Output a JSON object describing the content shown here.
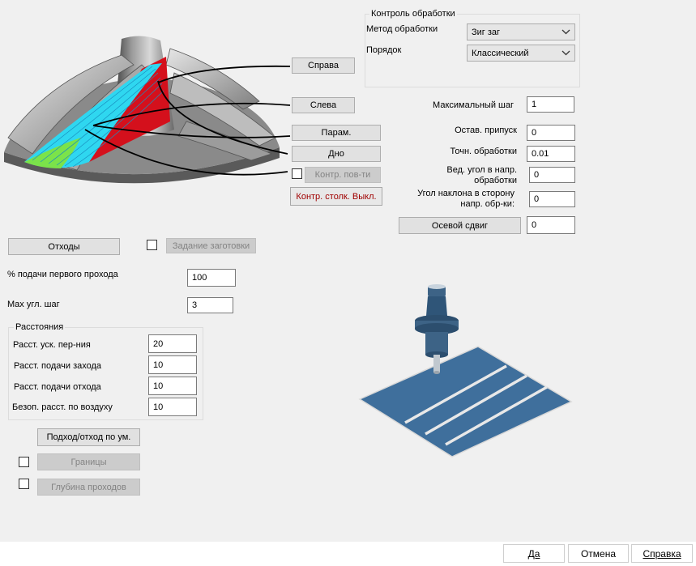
{
  "machining_control": {
    "title": "Контроль обработки",
    "method_label": "Метод обработки",
    "method_value": "Зиг заг",
    "order_label": "Порядок",
    "order_value": "Классический"
  },
  "image_buttons": {
    "right": "Справа",
    "left": "Слева",
    "params": "Парам.",
    "bottom": "Дно",
    "surface_check": "Контр. пов-ти",
    "collision_check": "Контр. столк. Выкл."
  },
  "params": {
    "max_step_label": "Максимальный шаг",
    "max_step_value": "1",
    "allowance_label": "Остав. припуск",
    "allowance_value": "0",
    "tolerance_label": "Точн. обработки",
    "tolerance_value": "0.01",
    "lead_angle_label_1": "Вед. угол в напр.",
    "lead_angle_label_2": "обработки",
    "lead_angle_value": "0",
    "tilt_angle_label_1": "Угол наклона в сторону",
    "tilt_angle_label_2": "напр. обр-ки:",
    "tilt_angle_value": "0",
    "axial_shift_label": "Осевой сдвиг",
    "axial_shift_value": "0"
  },
  "left": {
    "retract_button": "Отходы",
    "stock_button": "Задание заготовки",
    "first_pass_feed_label": "% подачи первого прохода",
    "first_pass_feed_value": "100",
    "max_angle_step_label": "Max угл. шаг",
    "max_angle_step_value": "3"
  },
  "distances": {
    "title": "Расстояния",
    "rapid_label": "Расст. уск. пер-ния",
    "rapid_value": "20",
    "approach_label": "Расст. подачи захода",
    "approach_value": "10",
    "retract_label": "Расст. подачи отхода",
    "retract_value": "10",
    "safe_label": "Безоп. расст. по воздуху",
    "safe_value": "10"
  },
  "bottom_left": {
    "default_link_button": "Подход/отход по ум.",
    "boundaries_button": "Границы",
    "depth_button": "Глубина проходов"
  },
  "footer": {
    "ok": "Да",
    "cancel": "Отмена",
    "help": "Справка"
  },
  "colors": {
    "dialog_bg": "#f0f0f0",
    "tool_blue": "#3d6386",
    "plate_blue": "#3f6f9c",
    "toolpath_cyan": "#2fd7f0",
    "toolpath_green": "#7be34a",
    "surface_red": "#d4101c"
  }
}
